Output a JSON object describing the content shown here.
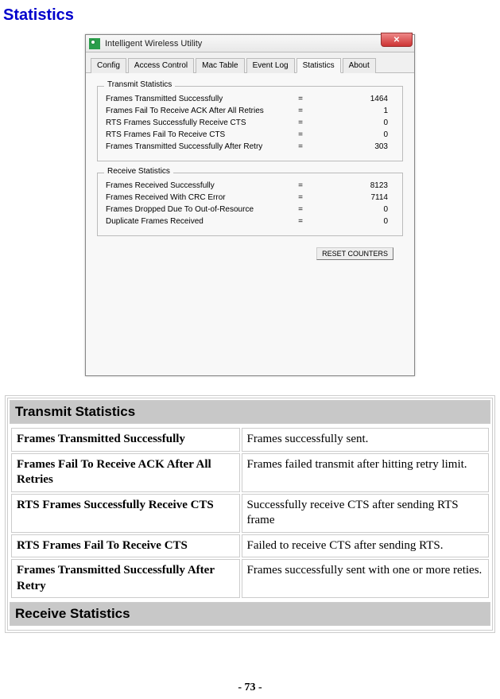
{
  "page": {
    "title": "Statistics",
    "footer": "- 73 -"
  },
  "window": {
    "title": "Intelligent Wireless Utility",
    "close_glyph": "✕",
    "tabs": [
      "Config",
      "Access Control",
      "Mac Table",
      "Event Log",
      "Statistics",
      "About"
    ],
    "active_tab_index": 4,
    "reset_button": "RESET COUNTERS"
  },
  "transmit_stats": {
    "legend": "Transmit Statistics",
    "rows": [
      {
        "label": "Frames Transmitted Successfully",
        "value": "1464"
      },
      {
        "label": "Frames Fail To Receive ACK After All Retries",
        "value": "1"
      },
      {
        "label": "RTS Frames Successfully Receive CTS",
        "value": "0"
      },
      {
        "label": "RTS Frames Fail To Receive CTS",
        "value": "0"
      },
      {
        "label": "Frames Transmitted Successfully After Retry",
        "value": "303"
      }
    ]
  },
  "receive_stats": {
    "legend": "Receive Statistics",
    "rows": [
      {
        "label": "Frames Received Successfully",
        "value": "8123"
      },
      {
        "label": "Frames Received With CRC Error",
        "value": "7114"
      },
      {
        "label": "Frames Dropped Due To Out-of-Resource",
        "value": "0"
      },
      {
        "label": "Duplicate Frames Received",
        "value": "0"
      }
    ]
  },
  "doc_sections": {
    "transmit_head": "Transmit Statistics",
    "receive_head": "Receive Statistics",
    "transmit_rows": [
      {
        "key": "Frames Transmitted Successfully",
        "desc": "Frames successfully sent."
      },
      {
        "key": "Frames Fail To Receive ACK After All Retries",
        "desc": "Frames failed transmit after hitting retry limit."
      },
      {
        "key": "RTS Frames Successfully Receive CTS",
        "desc": "Successfully receive CTS after sending RTS frame"
      },
      {
        "key": "RTS Frames Fail To Receive CTS",
        "desc": "Failed to receive CTS after sending RTS."
      },
      {
        "key": "Frames Transmitted Successfully After Retry",
        "desc": "Frames successfully sent with one or more reties."
      }
    ]
  }
}
